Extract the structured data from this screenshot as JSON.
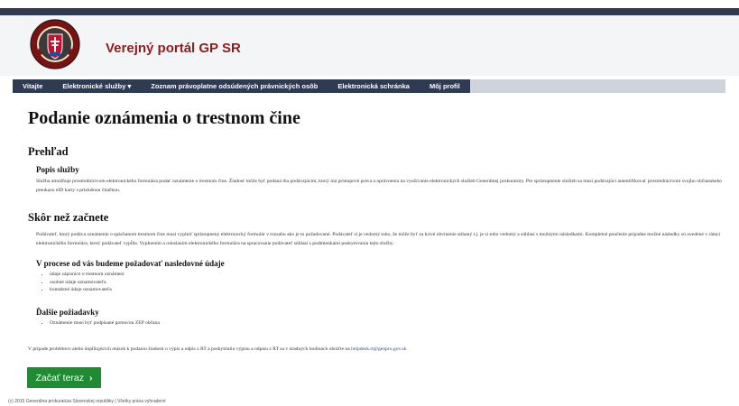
{
  "header": {
    "portal_title": "Verejný portál GP SR",
    "logo_icon": "prokuratura-crest-icon"
  },
  "nav": {
    "items": [
      {
        "label": "Vitajte"
      },
      {
        "label": "Elektronické služby ▾"
      },
      {
        "label": "Zoznam právoplatne odsúdených právnických osôb"
      },
      {
        "label": "Elektronická schránka"
      },
      {
        "label": "Môj profil"
      }
    ]
  },
  "main": {
    "title": "Podanie oznámenia o trestnom čine",
    "overview_heading": "Prehľad",
    "service_desc_heading": "Popis služby",
    "service_desc_text": "Služba umožňuje prostredníctvom elektronického formulára podať oznámenie o trestnom čine. Žiadosť môže byť podaná iba podávajúcim, ktorý má prístupové práva a oprávnenia na využívanie elektronických služieb Generálnej prokuratúry. Pre sprístupnenie služieb sa musí podávajúci autentifikovať prostredníctvom svojho občianskeho preukazu eID karty s príslušnou čítačkou.",
    "before_heading": "Skôr než začnete",
    "before_text": "Podávateľ, ktorý podáva oznámenie o spáchanom trestnom čine musí vyplniť sprístupnený elektronický formulár v rozsahu ako je to požadované. Podávateľ si je vedomý toho, že môže byť za krivé obvinenie stíhaný t.j. je si toho vedomý a súhlasí s možnými následkami. Kompletné poučenie prípadne možné následky sú uvedené v rámci elektronického formulára, ktorý podávateľ vypĺňa. Vyplnením a odoslaním elektronického formulára na spracovanie podávateľ súhlasí s podmienkami poskytovania tejto služby.",
    "required_heading": "V procese od vás budeme požadovať nasledovné údaje",
    "required_items": [
      "údaje zápisnice o trestnom oznámení",
      "osobné údaje oznamovateľa",
      "kontaktné údaje oznamovateľa"
    ],
    "additional_heading": "Ďalšie požiadavky",
    "additional_items": [
      "Oznámenie musí byť podpísané pomocou ZEP občana"
    ],
    "help_text": "V prípade problémov alebo doplňujúcich otázok k podaniu žiadosti o výpis a odpis z RT a poskytnutiu výpisu a odpisu z RT sa v úradných hodinách obráťte na",
    "help_email": "helpdesk.rt@genpro.gov.sk",
    "start_button": "Začať teraz",
    "start_button_icon": "chevron-right-icon"
  },
  "footer": {
    "text": "(c) 2015 Generálna prokuratúra Slovenskej republiky | Všetky práva vyhradené"
  },
  "colors": {
    "nav_bg": "#2f3b52",
    "title_red": "#8f1d1d",
    "button_green": "#1f8c33",
    "link_blue": "#2b4a8b"
  }
}
